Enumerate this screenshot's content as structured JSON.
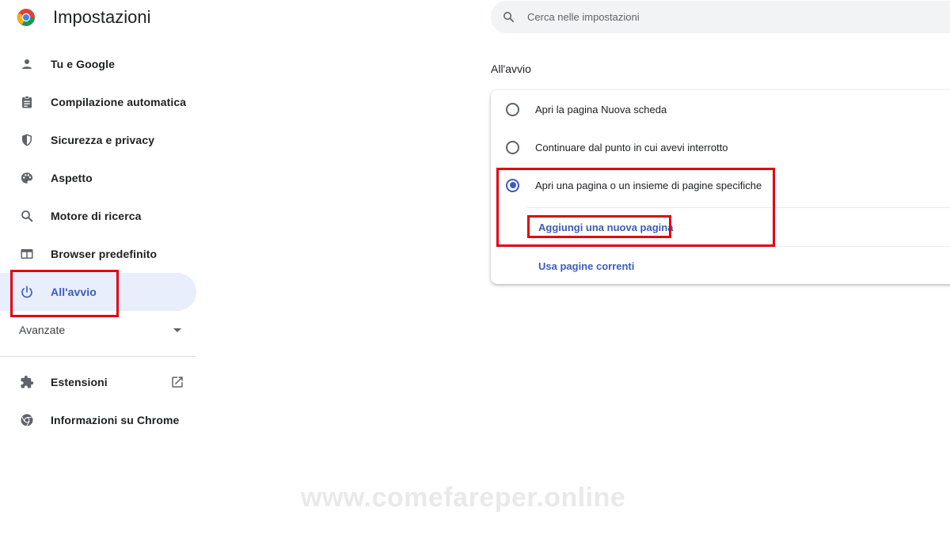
{
  "app": {
    "title": "Impostazioni"
  },
  "search": {
    "placeholder": "Cerca nelle impostazioni"
  },
  "sidebar": {
    "items": [
      {
        "label": "Tu e Google",
        "icon": "person-icon"
      },
      {
        "label": "Compilazione automatica",
        "icon": "clipboard-icon"
      },
      {
        "label": "Sicurezza e privacy",
        "icon": "shield-icon"
      },
      {
        "label": "Aspetto",
        "icon": "palette-icon"
      },
      {
        "label": "Motore di ricerca",
        "icon": "search-icon"
      },
      {
        "label": "Browser predefinito",
        "icon": "browser-window-icon"
      },
      {
        "label": "All'avvio",
        "icon": "power-icon",
        "active": true
      }
    ],
    "advanced_label": "Avanzate",
    "extensions_label": "Estensioni",
    "about_label": "Informazioni su Chrome"
  },
  "main": {
    "section_title": "All'avvio",
    "options": [
      {
        "label": "Apri la pagina Nuova scheda",
        "checked": false
      },
      {
        "label": "Continuare dal punto in cui avevi interrotto",
        "checked": false
      },
      {
        "label": "Apri una pagina o un insieme di pagine specifiche",
        "checked": true
      }
    ],
    "add_page_label": "Aggiungi una nuova pagina",
    "use_current_label": "Usa pagine correnti"
  },
  "watermark": "www.comefareper.online",
  "colors": {
    "accent": "#3c5bbf",
    "active_bg": "#e8eefc",
    "highlight": "#e3000f"
  }
}
